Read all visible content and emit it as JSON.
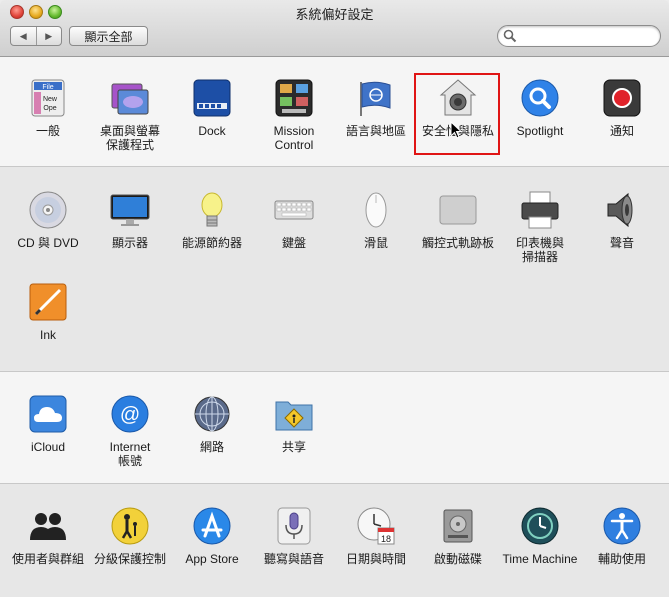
{
  "window": {
    "title": "系統偏好設定"
  },
  "toolbar": {
    "back_label": "◀",
    "forward_label": "▶",
    "show_all_label": "顯示全部",
    "search": {
      "value": "",
      "placeholder": ""
    }
  },
  "sections": [
    {
      "panes": [
        {
          "label": "一般",
          "icon": "general-icon"
        },
        {
          "label": "桌面與螢幕\n保護程式",
          "icon": "desktop-screensaver-icon"
        },
        {
          "label": "Dock",
          "icon": "dock-icon"
        },
        {
          "label": "Mission\nControl",
          "icon": "mission-control-icon"
        },
        {
          "label": "語言與地區",
          "icon": "language-region-icon"
        },
        {
          "label": "安全性與隱私",
          "icon": "security-privacy-icon"
        },
        {
          "label": "Spotlight",
          "icon": "spotlight-icon"
        },
        {
          "label": "通知",
          "icon": "notifications-icon"
        }
      ]
    },
    {
      "panes": [
        {
          "label": "CD 與 DVD",
          "icon": "cd-dvd-icon"
        },
        {
          "label": "顯示器",
          "icon": "displays-icon"
        },
        {
          "label": "能源節約器",
          "icon": "energy-saver-icon"
        },
        {
          "label": "鍵盤",
          "icon": "keyboard-icon"
        },
        {
          "label": "滑鼠",
          "icon": "mouse-icon"
        },
        {
          "label": "觸控式軌跡板",
          "icon": "trackpad-icon"
        },
        {
          "label": "印表機與\n掃描器",
          "icon": "printers-scanners-icon"
        },
        {
          "label": "聲音",
          "icon": "sound-icon"
        },
        {
          "label": "Ink",
          "icon": "ink-icon"
        }
      ]
    },
    {
      "panes": [
        {
          "label": "iCloud",
          "icon": "icloud-icon"
        },
        {
          "label": "Internet\n帳號",
          "icon": "internet-accounts-icon"
        },
        {
          "label": "網路",
          "icon": "network-icon"
        },
        {
          "label": "共享",
          "icon": "sharing-icon"
        }
      ]
    },
    {
      "panes": [
        {
          "label": "使用者與群組",
          "icon": "users-groups-icon"
        },
        {
          "label": "分級保護控制",
          "icon": "parental-controls-icon"
        },
        {
          "label": "App Store",
          "icon": "app-store-icon"
        },
        {
          "label": "聽寫與語音",
          "icon": "dictation-speech-icon"
        },
        {
          "label": "日期與時間",
          "icon": "date-time-icon"
        },
        {
          "label": "啟動磁碟",
          "icon": "startup-disk-icon"
        },
        {
          "label": "Time Machine",
          "icon": "time-machine-icon"
        },
        {
          "label": "輔助使用",
          "icon": "accessibility-icon"
        }
      ]
    }
  ],
  "icon_text": {
    "general_file": "File",
    "general_new": "New",
    "general_open": "Ope",
    "calendar_day": "18"
  },
  "highlight_color": "#e01515"
}
